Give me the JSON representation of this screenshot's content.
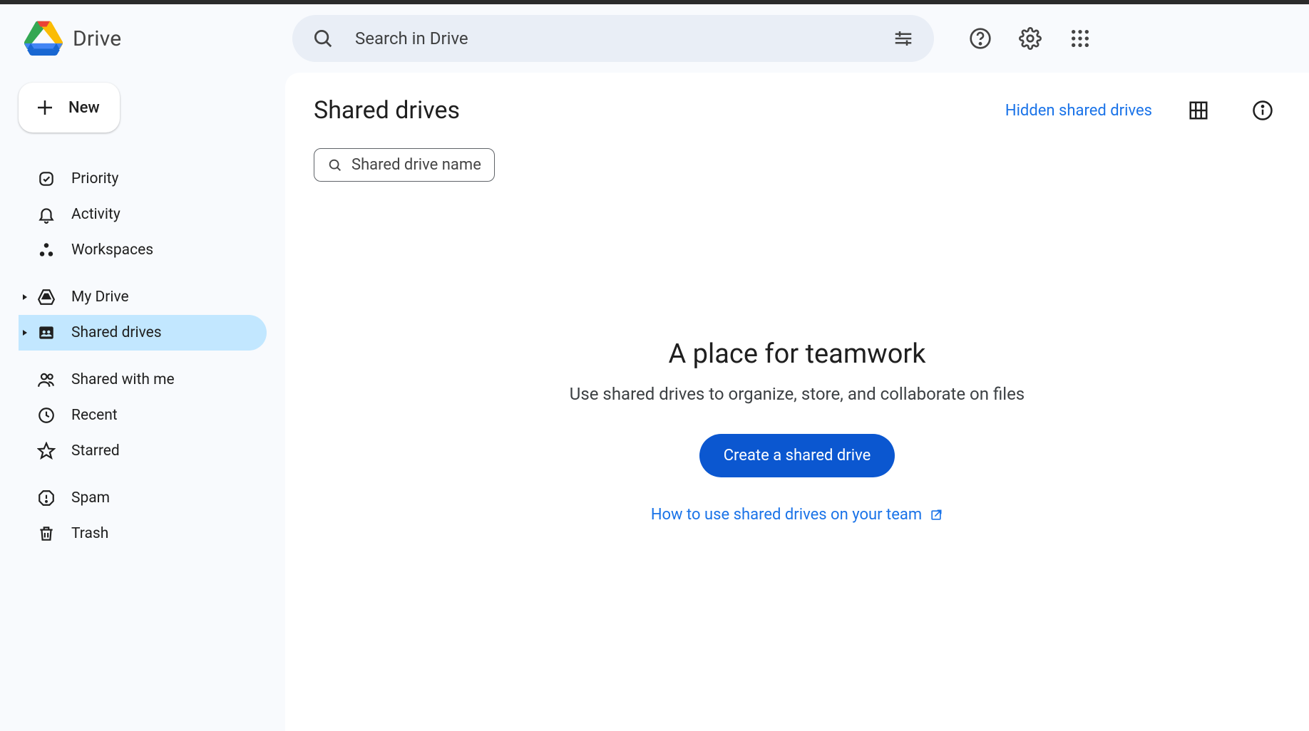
{
  "app": {
    "name": "Drive"
  },
  "search": {
    "placeholder": "Search in Drive"
  },
  "new_button": "New",
  "sidebar": {
    "priority": "Priority",
    "activity": "Activity",
    "workspaces": "Workspaces",
    "my_drive": "My Drive",
    "shared_drives": "Shared drives",
    "shared_with_me": "Shared with me",
    "recent": "Recent",
    "starred": "Starred",
    "spam": "Spam",
    "trash": "Trash"
  },
  "main": {
    "title": "Shared drives",
    "hidden_link": "Hidden shared drives",
    "filter_placeholder": "Shared drive name",
    "empty": {
      "title": "A place for teamwork",
      "subtitle": "Use shared drives to organize, store, and collaborate on files",
      "cta": "Create a shared drive",
      "learn": "How to use shared drives on your team"
    }
  }
}
